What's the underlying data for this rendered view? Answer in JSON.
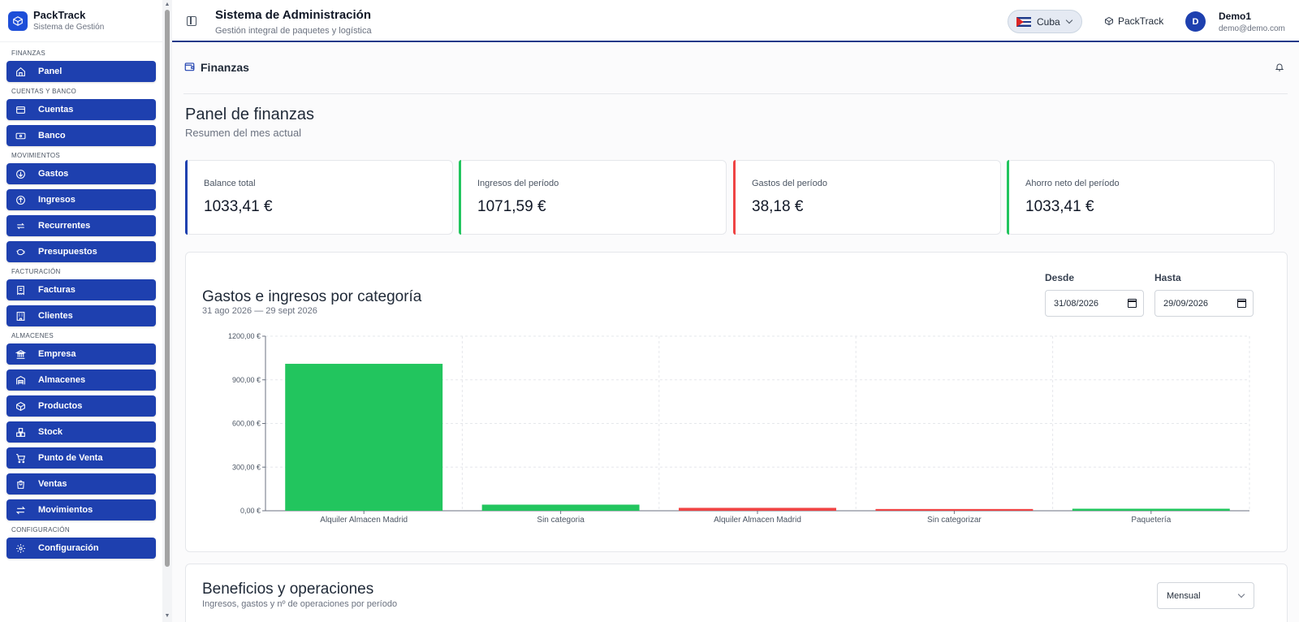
{
  "brand": {
    "name": "PackTrack",
    "subtitle": "Sistema de Gestión"
  },
  "sidebar": {
    "sections": [
      {
        "label": "FINANZAS",
        "items": [
          {
            "label": "Panel",
            "icon": "home-icon"
          }
        ]
      },
      {
        "label": "CUENTAS Y BANCO",
        "items": [
          {
            "label": "Cuentas",
            "icon": "credit-card-icon"
          },
          {
            "label": "Banco",
            "icon": "banknote-icon"
          }
        ]
      },
      {
        "label": "MOVIMIENTOS",
        "items": [
          {
            "label": "Gastos",
            "icon": "arrow-down-circle-icon"
          },
          {
            "label": "Ingresos",
            "icon": "arrow-up-circle-icon"
          },
          {
            "label": "Recurrentes",
            "icon": "repeat-icon"
          },
          {
            "label": "Presupuestos",
            "icon": "piggy-bank-icon"
          }
        ]
      },
      {
        "label": "FACTURACIÓN",
        "items": [
          {
            "label": "Facturas",
            "icon": "receipt-icon"
          },
          {
            "label": "Clientes",
            "icon": "building-icon"
          }
        ]
      },
      {
        "label": "ALMACENES",
        "items": [
          {
            "label": "Empresa",
            "icon": "landmark-icon"
          },
          {
            "label": "Almacenes",
            "icon": "warehouse-icon"
          },
          {
            "label": "Productos",
            "icon": "package-icon"
          },
          {
            "label": "Stock",
            "icon": "boxes-icon"
          },
          {
            "label": "Punto de Venta",
            "icon": "cart-icon"
          },
          {
            "label": "Ventas",
            "icon": "shopping-bag-icon"
          },
          {
            "label": "Movimientos",
            "icon": "arrows-left-right-icon"
          }
        ]
      },
      {
        "label": "CONFIGURACIÓN",
        "items": [
          {
            "label": "Configuración",
            "icon": "gear-icon"
          }
        ]
      }
    ]
  },
  "topbar": {
    "title": "Sistema de Administración",
    "subtitle": "Gestión integral de paquetes y logística",
    "country": "Cuba",
    "app_link": "PackTrack",
    "user": {
      "initial": "D",
      "name": "Demo1",
      "email": "demo@demo.com"
    }
  },
  "page": {
    "section_title": "Finanzas",
    "heading": "Panel de finanzas",
    "heading_sub": "Resumen del mes actual"
  },
  "stats": [
    {
      "label": "Balance total",
      "value": "1033,41 €",
      "color": "#1e40af"
    },
    {
      "label": "Ingresos del período",
      "value": "1071,59 €",
      "color": "#22c55e"
    },
    {
      "label": "Gastos del período",
      "value": "38,18 €",
      "color": "#ef4444"
    },
    {
      "label": "Ahorro neto del período",
      "value": "1033,41 €",
      "color": "#22c55e"
    }
  ],
  "category_chart": {
    "title": "Gastos e ingresos por categoría",
    "subtitle": "31 ago 2026 — 29 sept 2026",
    "from_label": "Desde",
    "from_value": "31/08/2026",
    "to_label": "Hasta",
    "to_value": "29/09/2026"
  },
  "chart_data": {
    "type": "bar",
    "categories": [
      "Alquiler Almacen Madrid",
      "Sin categoria",
      "Alquiler Almacen Madrid",
      "Sin categorizar",
      "Paquetería"
    ],
    "values": [
      1010,
      42,
      20,
      12,
      14
    ],
    "bar_colors": [
      "#22c55e",
      "#22c55e",
      "#ef4444",
      "#ef4444",
      "#22c55e"
    ],
    "yticks": [
      "0,00 €",
      "300,00 €",
      "600,00 €",
      "900,00 €",
      "1200,00 €"
    ],
    "ylim": [
      0,
      1200
    ],
    "grid": true
  },
  "profit_card": {
    "title": "Beneficios y operaciones",
    "subtitle": "Ingresos, gastos y nº de operaciones por período",
    "period": "Mensual"
  }
}
